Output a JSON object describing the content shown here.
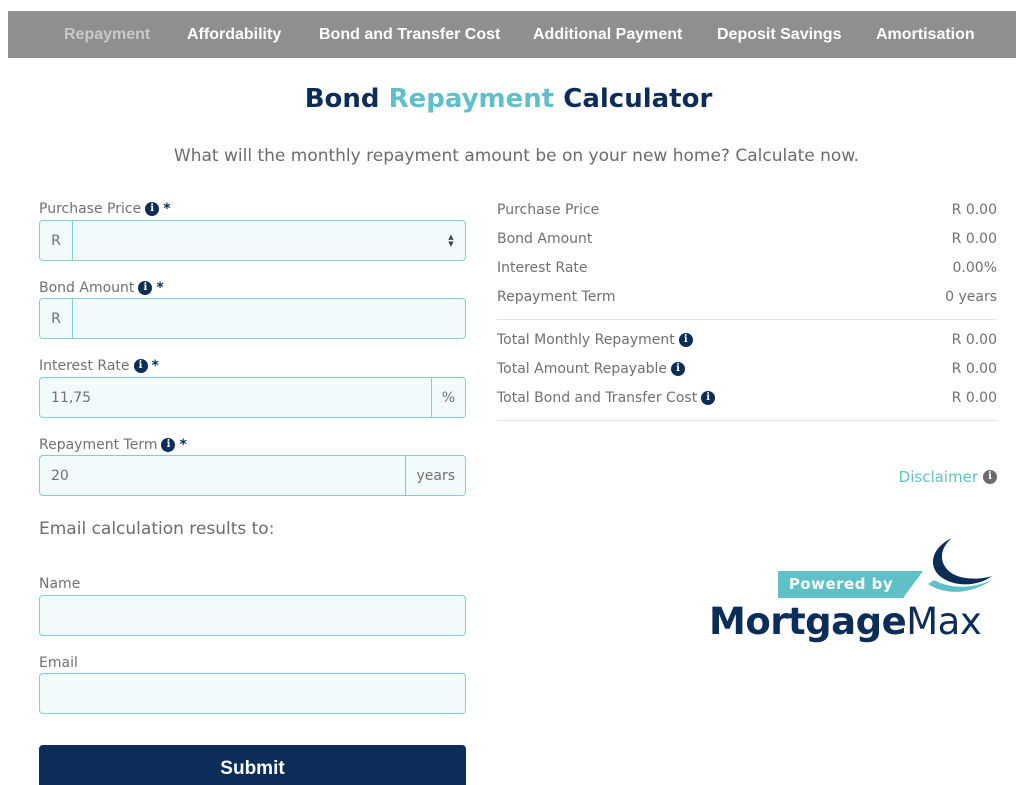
{
  "nav": {
    "tabs": [
      {
        "label": "Repayment",
        "active": true
      },
      {
        "label": "Affordability",
        "active": false
      },
      {
        "label": "Bond and Transfer Cost",
        "active": false
      },
      {
        "label": "Additional Payment",
        "active": false
      },
      {
        "label": "Deposit Savings",
        "active": false
      },
      {
        "label": "Amortisation",
        "active": false
      }
    ]
  },
  "header": {
    "title_part1": "Bond",
    "title_accent": "Repayment",
    "title_part2": "Calculator",
    "subtitle": "What will the monthly repayment amount be on your new home? Calculate now."
  },
  "form": {
    "purchase_price": {
      "label": "Purchase Price",
      "required": "*",
      "prefix": "R",
      "value": ""
    },
    "bond_amount": {
      "label": "Bond Amount",
      "required": "*",
      "prefix": "R",
      "value": ""
    },
    "interest_rate": {
      "label": "Interest Rate",
      "required": "*",
      "suffix": "%",
      "value": "11,75"
    },
    "repayment_term": {
      "label": "Repayment Term",
      "required": "*",
      "suffix": "years",
      "value": "20"
    },
    "email_heading": "Email calculation results to:",
    "name": {
      "label": "Name",
      "value": ""
    },
    "email": {
      "label": "Email",
      "value": ""
    },
    "submit_label": "Submit"
  },
  "results": {
    "rows": [
      {
        "label": "Purchase Price",
        "value": "R 0.00"
      },
      {
        "label": "Bond Amount",
        "value": "R 0.00"
      },
      {
        "label": "Interest Rate",
        "value": "0.00%"
      },
      {
        "label": "Repayment Term",
        "value": "0 years"
      }
    ],
    "totals": [
      {
        "label": "Total Monthly Repayment",
        "value": "R 0.00"
      },
      {
        "label": "Total Amount Repayable",
        "value": "R 0.00"
      },
      {
        "label": "Total Bond and Transfer Cost",
        "value": "R 0.00"
      }
    ],
    "disclaimer": "Disclaimer"
  },
  "logo": {
    "powered_by": "Powered by",
    "brand_bold": "Mortgage",
    "brand_light": "Max"
  },
  "colors": {
    "navy": "#0c2d57",
    "teal": "#5fc0c8",
    "tab_bar": "#8f8f8f",
    "field_border": "#7fd0d6"
  },
  "icons": {
    "info": "info-icon",
    "spinner": "number-spinner-icon",
    "logo_swoosh": "swoosh-logo-icon"
  }
}
